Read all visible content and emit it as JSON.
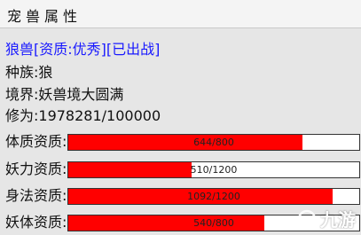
{
  "window": {
    "title": "宠兽属性"
  },
  "pet": {
    "header": "狼兽[资质:优秀][已出战]",
    "race": "种族:狼",
    "realm": "境界:妖兽境大圆满",
    "cultivation": "修为:1978281/100000"
  },
  "stats": [
    {
      "label": "体质资质:",
      "text": "644/800",
      "fraction": 0.805
    },
    {
      "label": "妖力资质:",
      "text": "510/1200",
      "fraction": 0.425
    },
    {
      "label": "身法资质:",
      "text": "1092/1200",
      "fraction": 0.91
    },
    {
      "label": "妖体资质:",
      "text": "540/800",
      "fraction": 0.675
    }
  ],
  "watermark": {
    "text": "九游"
  },
  "colors": {
    "bar_fill": "#ff0000",
    "bar_bg": "#ffffff",
    "header_text": "#1a1aff"
  }
}
